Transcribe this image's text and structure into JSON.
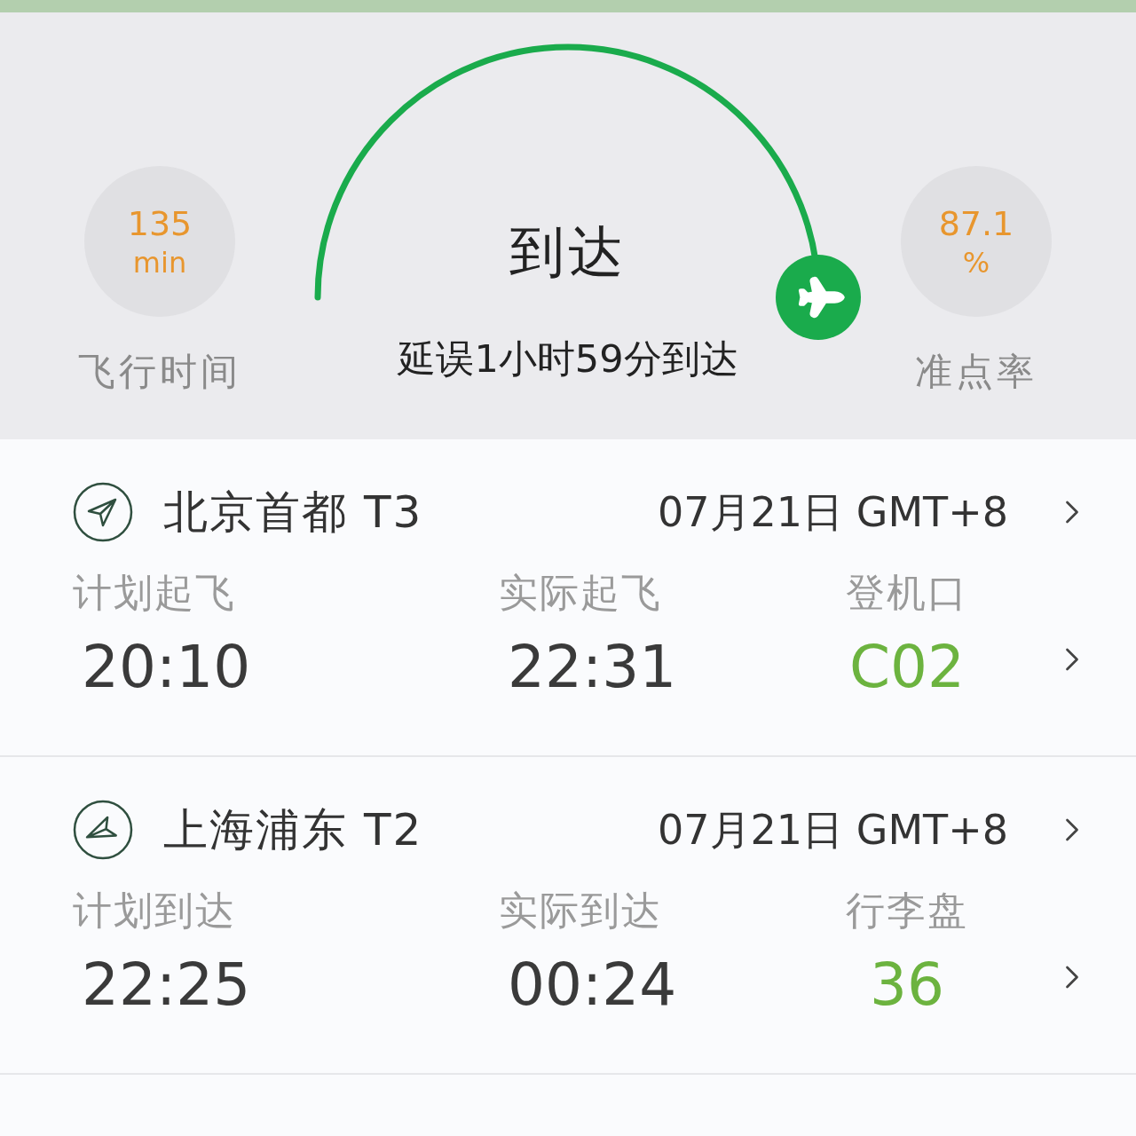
{
  "status": {
    "title": "到达",
    "detail": "延误1小时59分到达"
  },
  "stats": [
    {
      "value": "135",
      "unit": "min",
      "label": "飞行时间"
    },
    {
      "value": "87.1",
      "unit": "%",
      "label": "准点率"
    }
  ],
  "airports": [
    {
      "kind": "departure",
      "name": "北京首都 T3",
      "date": "07月21日 GMT+8",
      "fields": [
        {
          "label": "计划起飞",
          "value": "20:10",
          "highlight": false
        },
        {
          "label": "实际起飞",
          "value": "22:31",
          "highlight": false
        },
        {
          "label": "登机口",
          "value": "C02",
          "highlight": true
        }
      ]
    },
    {
      "kind": "arrival",
      "name": "上海浦东 T2",
      "date": "07月21日 GMT+8",
      "fields": [
        {
          "label": "计划到达",
          "value": "22:25",
          "highlight": false
        },
        {
          "label": "实际到达",
          "value": "00:24",
          "highlight": false
        },
        {
          "label": "行李盘",
          "value": "36",
          "highlight": true
        }
      ]
    }
  ]
}
